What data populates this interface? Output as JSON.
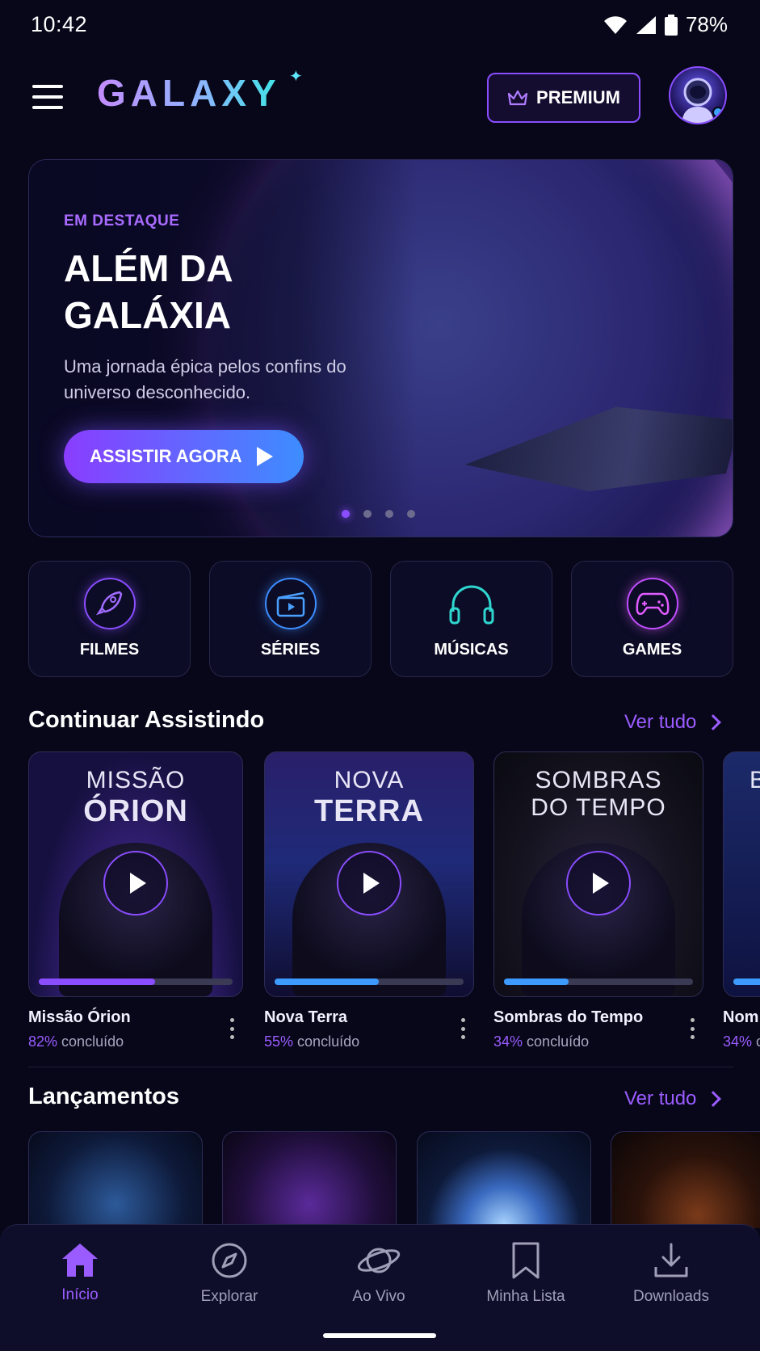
{
  "status_bar": {
    "time": "10:42",
    "battery": "78%"
  },
  "header": {
    "logo": "GALAXY",
    "premium_label": "PREMIUM"
  },
  "hero": {
    "eyebrow": "EM DESTAQUE",
    "title": "ALÉM DA GALÁXIA",
    "subtitle": "Uma jornada épica pelos confins do universo desconhecido.",
    "cta": "ASSISTIR AGORA",
    "carousel_active_index": 0,
    "carousel_count": 4
  },
  "categories": [
    {
      "label": "FILMES",
      "icon": "rocket-icon",
      "color": "#8a4dff"
    },
    {
      "label": "SÉRIES",
      "icon": "clapperboard-icon",
      "color": "#3d8dff"
    },
    {
      "label": "MÚSICAS",
      "icon": "headphones-icon",
      "color": "#2fd6d0"
    },
    {
      "label": "GAMES",
      "icon": "gamepad-icon",
      "color": "#e05cff"
    }
  ],
  "continue_watching": {
    "title": "Continuar Assistindo",
    "see_all": "Ver tudo",
    "suffix": "concluído",
    "items": [
      {
        "poster_line1": "MISSÃO",
        "poster_line2": "ÓRION",
        "name": "Missão Órion",
        "percent": "82%",
        "progress": 0.6,
        "bar_color": "#8a4dff"
      },
      {
        "poster_line1": "NOVA",
        "poster_line2": "TERRA",
        "name": "Nova Terra",
        "percent": "55%",
        "progress": 0.55,
        "bar_color": "#3d9bff"
      },
      {
        "poster_line1": "SOMBRAS",
        "poster_line2": "DO TEMPO",
        "name": "Sombras do Tempo",
        "percent": "34%",
        "progress": 0.34,
        "bar_color": "#3d9bff"
      },
      {
        "poster_line1": "B",
        "poster_line2": "",
        "name": "Nom",
        "percent": "34%",
        "progress": 0.34,
        "bar_color": "#3d9bff"
      }
    ]
  },
  "releases": {
    "title": "Lançamentos",
    "see_all": "Ver tudo"
  },
  "bottom_nav": [
    {
      "label": "Início",
      "icon": "home-icon",
      "active": true
    },
    {
      "label": "Explorar",
      "icon": "compass-icon",
      "active": false
    },
    {
      "label": "Ao Vivo",
      "icon": "planet-icon",
      "active": false
    },
    {
      "label": "Minha Lista",
      "icon": "bookmark-icon",
      "active": false
    },
    {
      "label": "Downloads",
      "icon": "download-icon",
      "active": false
    }
  ],
  "colors": {
    "accent": "#8a4dff",
    "background": "#070719",
    "secondary_accent": "#3d8dff"
  }
}
